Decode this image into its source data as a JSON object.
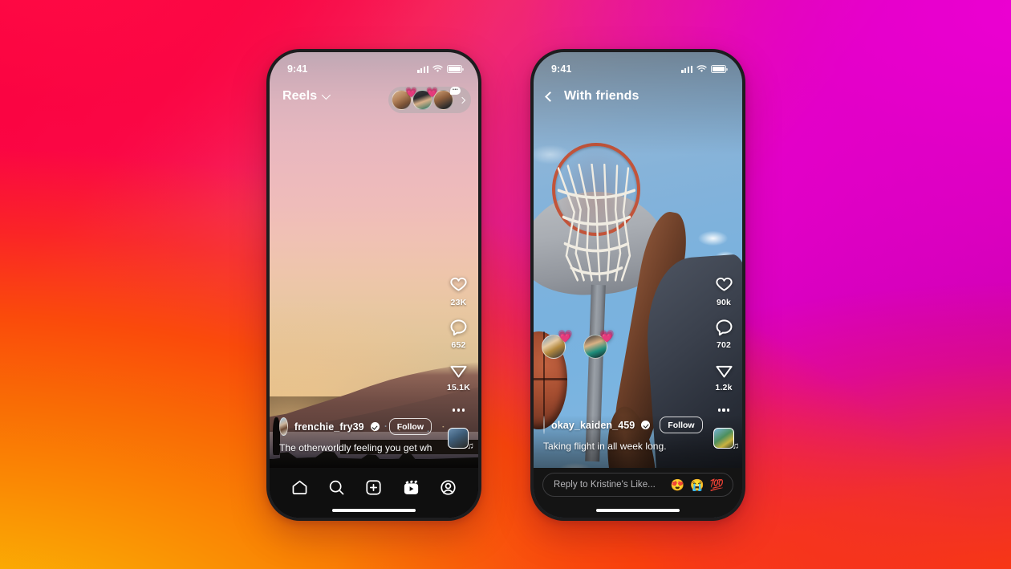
{
  "background": {
    "colors": {
      "top_left": "#fa0341",
      "top_right": "#e300c8",
      "mid_left": "#f96b05",
      "bottom_left": "#fbb303",
      "bottom_right": "#fa3a0c"
    }
  },
  "phones": [
    {
      "id": "reels-feed",
      "status_bar": {
        "time": "9:41",
        "signal_icon": "cellular-signal-icon",
        "wifi_icon": "wifi-icon",
        "battery_icon": "battery-icon"
      },
      "header": {
        "title": "Reels",
        "chevron_icon": "chevron-down-icon",
        "story_pill": {
          "avatars": [
            {
              "name": "story-avatar-1",
              "badge": "heart-reaction",
              "badge_glyph": "💗"
            },
            {
              "name": "story-avatar-2",
              "badge": "heart-reaction",
              "badge_glyph": "💗"
            },
            {
              "name": "story-avatar-3",
              "badge": "comment-bubble",
              "badge_text": "•••"
            }
          ],
          "chevron_icon": "chevron-right-icon"
        }
      },
      "media": {
        "description": "sunset-over-bay-silhouettes"
      },
      "rail": [
        {
          "icon": "heart-icon",
          "count": "23K",
          "name": "like-button"
        },
        {
          "icon": "comment-icon",
          "count": "652",
          "name": "comment-button"
        },
        {
          "icon": "share-icon",
          "count": "15.1K",
          "name": "share-button"
        },
        {
          "icon": "more-options-icon",
          "count": "",
          "name": "more-button"
        }
      ],
      "audio": {
        "name": "audio-track-thumbnail",
        "note_glyph": "♫"
      },
      "post": {
        "username": "frenchie_fry39",
        "verified": true,
        "follow_label": "Follow",
        "caption": "The otherworldly feeling you get when you d..."
      },
      "bottom_nav": [
        {
          "name": "nav-home",
          "icon": "home-icon",
          "active": false
        },
        {
          "name": "nav-search",
          "icon": "search-icon",
          "active": false
        },
        {
          "name": "nav-create",
          "icon": "plus-square-icon",
          "active": false
        },
        {
          "name": "nav-reels",
          "icon": "reels-icon",
          "active": true
        },
        {
          "name": "nav-profile",
          "icon": "profile-icon",
          "active": false
        }
      ]
    },
    {
      "id": "with-friends",
      "status_bar": {
        "time": "9:41",
        "signal_icon": "cellular-signal-icon",
        "wifi_icon": "wifi-icon",
        "battery_icon": "battery-icon"
      },
      "header": {
        "title": "With friends",
        "back_icon": "back-chevron-icon"
      },
      "media": {
        "description": "low-angle-basketball-hoop-dunk"
      },
      "floating_reactions": [
        {
          "name": "friend-reaction-1",
          "badge_glyph": "💗"
        },
        {
          "name": "friend-reaction-2",
          "badge_glyph": "💗"
        }
      ],
      "rail": [
        {
          "icon": "heart-icon",
          "count": "90k",
          "name": "like-button"
        },
        {
          "icon": "comment-icon",
          "count": "702",
          "name": "comment-button"
        },
        {
          "icon": "share-icon",
          "count": "1.2k",
          "name": "share-button"
        },
        {
          "icon": "more-options-icon",
          "count": "",
          "name": "more-button"
        }
      ],
      "audio": {
        "name": "audio-track-thumbnail",
        "note_glyph": "♫"
      },
      "post": {
        "username": "okay_kaiden_459",
        "verified": true,
        "follow_label": "Follow",
        "caption": "Taking flight in all week long."
      },
      "reply": {
        "placeholder": "Reply to Kristine's Like...",
        "emojis": [
          "😍",
          "😭",
          "💯"
        ]
      }
    }
  ]
}
